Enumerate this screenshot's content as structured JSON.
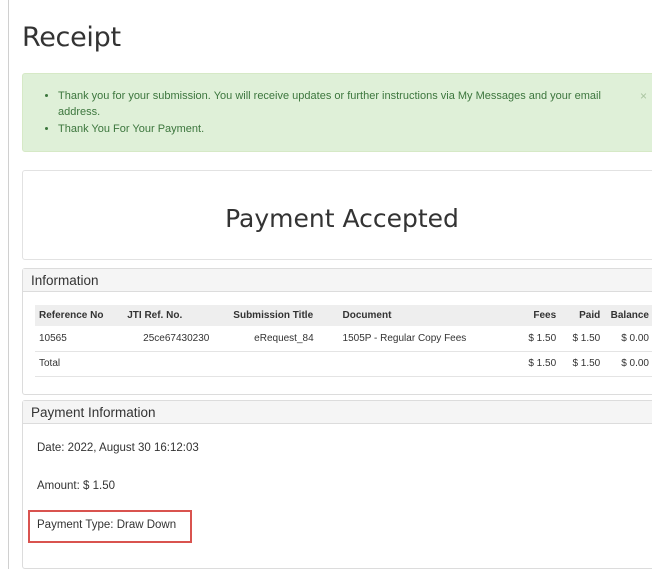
{
  "page": {
    "title": "Receipt"
  },
  "alert": {
    "messages": [
      "Thank you for your submission. You will receive updates or further instructions via My Messages and your email address.",
      "Thank You For Your Payment."
    ],
    "close_glyph": "×"
  },
  "status": {
    "heading": "Payment Accepted"
  },
  "information": {
    "heading": "Information",
    "columns": [
      "Reference No",
      "JTI Ref. No.",
      "Submission Title",
      "Document",
      "Fees",
      "Paid",
      "Balance"
    ],
    "rows": [
      [
        "10565",
        "25ce67430230",
        "eRequest_84",
        "1505P - Regular Copy Fees",
        "$ 1.50",
        "$ 1.50",
        "$ 0.00"
      ]
    ],
    "total": {
      "label": "Total",
      "fees": "$ 1.50",
      "paid": "$ 1.50",
      "balance": "$ 0.00"
    }
  },
  "payment_information": {
    "heading": "Payment Information",
    "date": "Date: 2022, August 30 16:12:03",
    "amount": "Amount: $ 1.50",
    "payment_type": "Payment Type: Draw Down"
  },
  "colors": {
    "alert_bg": "#dff0d8",
    "alert_text": "#3c763d",
    "highlight_border": "#d9534f"
  }
}
